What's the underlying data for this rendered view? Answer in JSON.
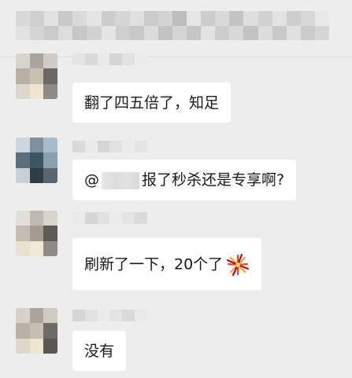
{
  "messages": [
    {
      "text": "翻了四五倍了，知足"
    },
    {
      "prefix": "@",
      "text": "报了秒杀还是专享啊?"
    },
    {
      "text": "刷新了一下，20个了",
      "emoji_icon": "fireworks-icon"
    },
    {
      "text": "没有"
    }
  ],
  "colors": {
    "background": "#ededed",
    "bubble": "#ffffff",
    "text": "#191919"
  }
}
